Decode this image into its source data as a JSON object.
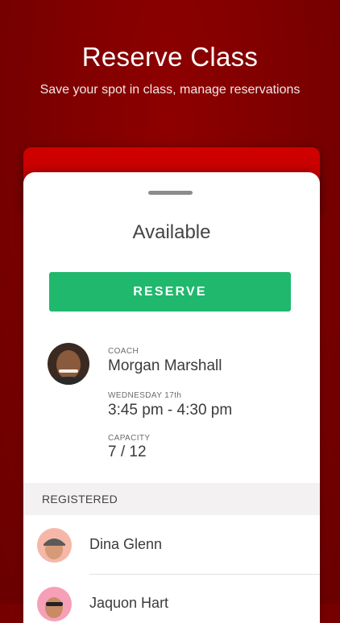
{
  "hero": {
    "title": "Reserve Class",
    "subtitle": "Save your spot in class, manage reservations"
  },
  "sheet": {
    "status": "Available",
    "reserve_label": "RESERVE",
    "coach": {
      "label": "COACH",
      "name": "Morgan Marshall"
    },
    "schedule": {
      "label": "WEDNESDAY 17th",
      "time": "3:45 pm - 4:30 pm"
    },
    "capacity": {
      "label": "CAPACITY",
      "value": "7 / 12"
    }
  },
  "registered": {
    "header": "REGISTERED",
    "members": [
      {
        "name": "Dina Glenn"
      },
      {
        "name": "Jaquon Hart"
      }
    ]
  },
  "colors": {
    "background": "#7a0000",
    "accent_red": "#c40000",
    "reserve_green": "#1fb86d"
  }
}
